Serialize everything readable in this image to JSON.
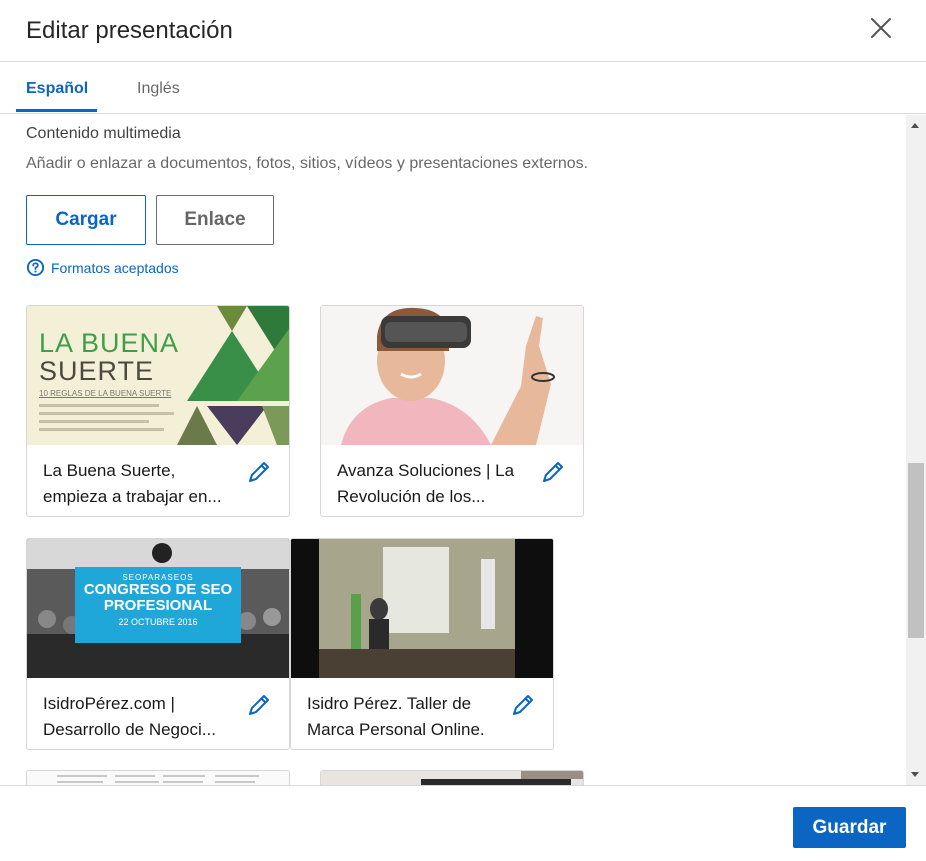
{
  "dialog": {
    "title": "Editar presentación"
  },
  "tabs": [
    {
      "label": "Español",
      "active": true
    },
    {
      "label": "Inglés",
      "active": false
    }
  ],
  "media": {
    "section_label": "Contenido multimedia",
    "description": "Añadir o enlazar a documentos, fotos, sitios, vídeos y presentaciones externos.",
    "upload_label": "Cargar",
    "link_label": "Enlace",
    "formats_label": "Formatos aceptados"
  },
  "items": [
    {
      "line1": "La Buena Suerte,",
      "line2": "empieza a trabajar en...",
      "thumb": {
        "heading1": "LA BUENA",
        "heading2": "SUERTE",
        "subheading": "10 REGLAS DE LA BUENA SUERTE"
      }
    },
    {
      "line1": "Avanza Soluciones | La",
      "line2": "Revolución de los..."
    },
    {
      "line1": "IsidroPérez.com |",
      "line2": "Desarrollo de Negoci...",
      "thumb": {
        "small": "SEOPARASEOS",
        "heading1": "CONGRESO DE SEO",
        "heading2": "PROFESIONAL",
        "date": "22 OCTUBRE 2016"
      }
    },
    {
      "line1": "Isidro Pérez. Taller de",
      "line2": "Marca Personal Online."
    }
  ],
  "footer": {
    "save_label": "Guardar"
  },
  "colors": {
    "accent": "#0a66c2",
    "border": "#d9d9d9"
  },
  "icons": {
    "close": "close-icon",
    "help": "question-circle-icon",
    "edit": "pencil-icon"
  }
}
